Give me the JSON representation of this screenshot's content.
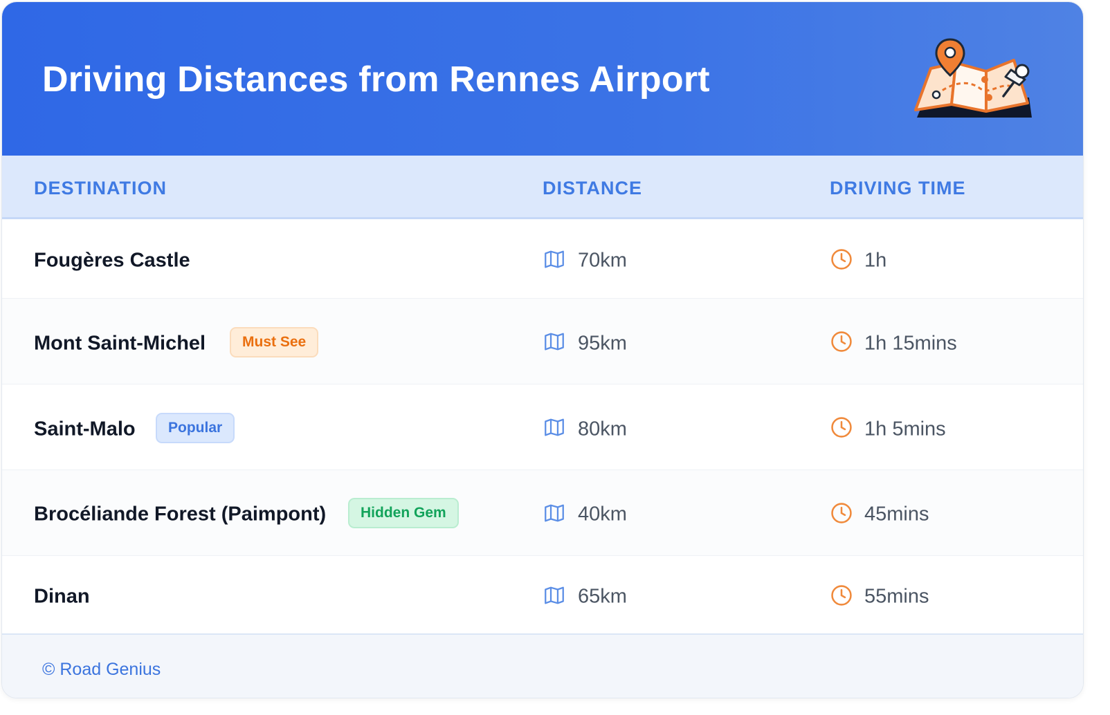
{
  "header": {
    "title": "Driving Distances from Rennes Airport",
    "illustration_icon": "folded-map-with-pins-icon",
    "gradient_colors": [
      "#2f68e6",
      "#4f82e4"
    ]
  },
  "table": {
    "columns": [
      "DESTINATION",
      "DISTANCE",
      "DRIVING TIME"
    ],
    "distance_icon": "map-icon",
    "time_icon": "clock-icon",
    "rows": [
      {
        "destination": "Fougères Castle",
        "badge": "",
        "distance": "70km",
        "time": "1h"
      },
      {
        "destination": "Mont Saint-Michel",
        "badge": "Must See",
        "distance": "95km",
        "time": "1h 15mins"
      },
      {
        "destination": "Saint-Malo",
        "badge": "Popular",
        "distance": "80km",
        "time": "1h 5mins"
      },
      {
        "destination": "Brocéliande Forest (Paimpont)",
        "badge": "Hidden Gem",
        "distance": "40km",
        "time": "45mins"
      },
      {
        "destination": "Dinan",
        "badge": "",
        "distance": "65km",
        "time": "55mins"
      }
    ]
  },
  "footer": {
    "credit": "© Road Genius"
  },
  "colors": {
    "accent_blue": "#3f7ae3",
    "must_see_orange": "#ea6f0f",
    "popular_blue": "#3b74de",
    "hidden_gem_green": "#12a35a",
    "clock_orange": "#f08a3c"
  }
}
